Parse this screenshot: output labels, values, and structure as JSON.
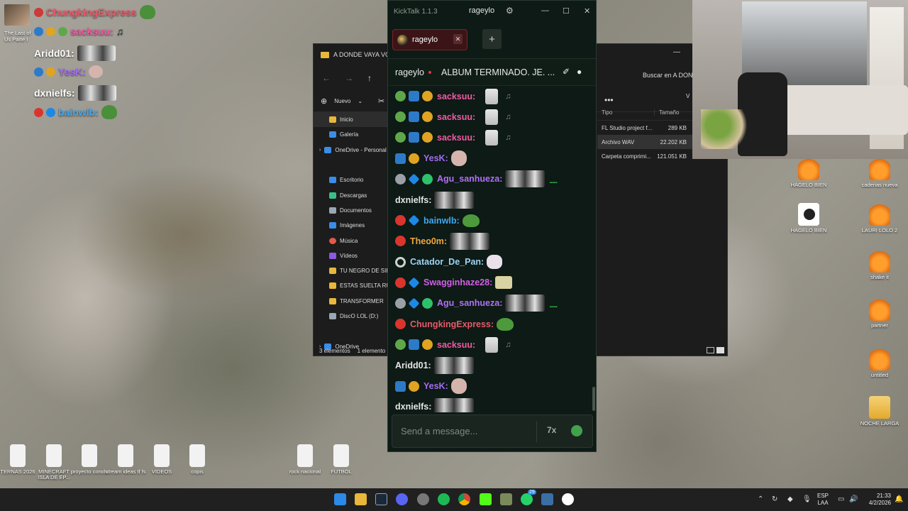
{
  "overlay_chat": [
    {
      "user": "ChungkingExpress",
      "color": "#e8596a"
    },
    {
      "user": "sacksuu:",
      "color": "#f05aa3"
    },
    {
      "user": "Aridd01:",
      "color": "#ffffff"
    },
    {
      "user": "YesK:",
      "color": "#a36cf0"
    },
    {
      "user": "dxnielfs:",
      "color": "#ffffff"
    },
    {
      "user": "bainwlb:",
      "color": "#3fa9f5"
    }
  ],
  "overlay_game_label": "The Last of Us Parte I",
  "explorer": {
    "title": "A DONDE VAYA VOY",
    "search_label": "Buscar en A DONDE VAYA VOY",
    "new_label": "Nuevo",
    "view_label": "V",
    "nav": [
      "Inicio",
      "Galería",
      "OneDrive - Personal",
      "Escritorio",
      "Descargas",
      "Documentos",
      "Imágenes",
      "Música",
      "Vídeos",
      "TU NEGRO DE SIEMPRE",
      "ESTAS SUELTA RUBIA",
      "TRANSFORMER",
      "DiscO LOL (D:)",
      "OneDrive"
    ],
    "columns": [
      "Tipo",
      "Tamaño"
    ],
    "rows": [
      {
        "type": "FL Studio project f...",
        "size": "289 KB"
      },
      {
        "type": "Archivo WAV",
        "size": "22.202 KB"
      },
      {
        "type": "Carpeta comprimi...",
        "size": "121.051 KB"
      }
    ],
    "status": [
      "3 elementos",
      "1 elemento"
    ]
  },
  "kicktalk": {
    "app_title": "KickTalk 1.1.3",
    "title_user": "rageylo",
    "tab_label": "rageylo",
    "channel": "rageylo",
    "stream_title": "ALBUM TERMINADO. JE. ...",
    "input_placeholder": "Send a message...",
    "messages": [
      {
        "badges": [
          "b-frog",
          "b-hammer",
          "b-coin"
        ],
        "user": "sacksuu:",
        "color": "#f05aa3",
        "emotes": [
          "e-girl",
          "e-note"
        ]
      },
      {
        "badges": [
          "b-frog",
          "b-hammer",
          "b-coin"
        ],
        "user": "sacksuu:",
        "color": "#f05aa3",
        "emotes": [
          "e-girl",
          "e-note"
        ]
      },
      {
        "badges": [
          "b-frog",
          "b-hammer",
          "b-coin"
        ],
        "user": "sacksuu:",
        "color": "#f05aa3",
        "emotes": [
          "e-girl",
          "e-note"
        ]
      },
      {
        "badges": [
          "b-hammer",
          "b-coin"
        ],
        "user": "YesK:",
        "color": "#a36cf0",
        "emotes": [
          "e-blob"
        ]
      },
      {
        "badges": [
          "b-clock",
          "b-cube",
          "b-verified"
        ],
        "user": "Agu_sanhueza:",
        "color": "#b070f5",
        "emotes": [
          "e-bw",
          "e-dots"
        ]
      },
      {
        "badges": [],
        "user": "dxnielfs:",
        "color": "#e6e6e6",
        "emotes": [
          "e-bw"
        ]
      },
      {
        "badges": [
          "b-red",
          "b-cube"
        ],
        "user": "bainwlb:",
        "color": "#3fa9f5",
        "emotes": [
          "e-frog"
        ]
      },
      {
        "badges": [
          "b-red"
        ],
        "user": "Theo0m:",
        "color": "#f2a541",
        "emotes": [
          "e-bw"
        ]
      },
      {
        "badges": [
          "b-ring"
        ],
        "user": "Catador_De_Pan:",
        "color": "#9fd3f5",
        "emotes": [
          "e-cat"
        ]
      },
      {
        "badges": [
          "b-red",
          "b-cube"
        ],
        "user": "Swagginhaze28:",
        "color": "#d35ee8",
        "emotes": [
          "e-bag"
        ]
      },
      {
        "badges": [
          "b-clock",
          "b-cube",
          "b-verified"
        ],
        "user": "Agu_sanhueza:",
        "color": "#b070f5",
        "emotes": [
          "e-bw",
          "e-dots"
        ]
      },
      {
        "badges": [
          "b-red"
        ],
        "user": "ChungkingExpress:",
        "color": "#e8596a",
        "emotes": [
          "e-frog"
        ]
      },
      {
        "badges": [
          "b-frog",
          "b-hammer",
          "b-coin"
        ],
        "user": "sacksuu:",
        "color": "#f05aa3",
        "emotes": [
          "e-girl",
          "e-note"
        ]
      },
      {
        "badges": [],
        "user": "Aridd01:",
        "color": "#e6e6e6",
        "emotes": [
          "e-bw"
        ]
      },
      {
        "badges": [
          "b-hammer",
          "b-coin"
        ],
        "user": "YesK:",
        "color": "#a36cf0",
        "emotes": [
          "e-blob"
        ]
      },
      {
        "badges": [],
        "user": "dxnielfs:",
        "color": "#e6e6e6",
        "emotes": [
          "e-bw"
        ]
      }
    ]
  },
  "desktop_icons_right": [
    {
      "label": "HAGELO BIEN",
      "kind": "fl"
    },
    {
      "label": "cadenas nueva",
      "kind": "fl"
    },
    {
      "label": "HAGELO BIEN",
      "kind": "play"
    },
    {
      "label": "LAURI LOLO 2",
      "kind": "fl"
    },
    {
      "label": "shake it",
      "kind": "fl"
    },
    {
      "label": "partner",
      "kind": "fl"
    },
    {
      "label": "untitled",
      "kind": "fl"
    },
    {
      "label": "NOCHE LARGA",
      "kind": "folder"
    }
  ],
  "desktop_icons_bottom": [
    {
      "label": "TERNAS 2026"
    },
    {
      "label": "MINECRAFT ISLA DE EP..."
    },
    {
      "label": "proyecto conolv"
    },
    {
      "label": "stream ideas tf fs"
    },
    {
      "label": "VIDEOS"
    },
    {
      "label": "copis"
    },
    {
      "label": "rock nacional"
    },
    {
      "label": "FUTBOL"
    }
  ],
  "taskbar": {
    "lang_top": "ESP",
    "lang_bottom": "LAA",
    "time": "21:33",
    "date": "4/2/2026",
    "whatsapp_badge": "29"
  }
}
